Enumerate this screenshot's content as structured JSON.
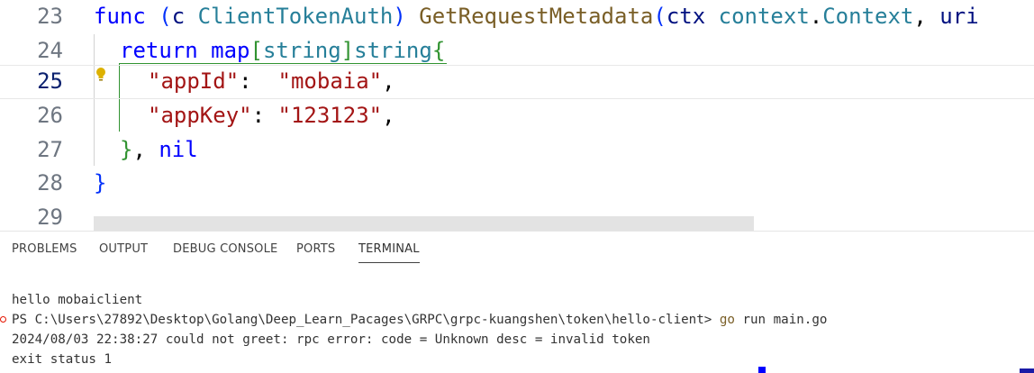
{
  "editor": {
    "lines": [
      {
        "num": "23"
      },
      {
        "num": "24"
      },
      {
        "num": "25"
      },
      {
        "num": "26"
      },
      {
        "num": "27"
      },
      {
        "num": "28"
      },
      {
        "num": "29"
      }
    ],
    "l23": {
      "func": "func",
      "open": "(",
      "recv": "c",
      "type": "ClientTokenAuth",
      "close": ")",
      "name": "GetRequestMetadata",
      "paren": "(",
      "param": "ctx",
      "pkg": "context",
      "dot": ".",
      "ctxType": "Context",
      "comma": ",",
      "tail": "uri"
    },
    "l24": {
      "ret": "return",
      "map": "map",
      "lb": "[",
      "keyType": "string",
      "rb": "]",
      "valType": "string",
      "brace": "{"
    },
    "l25": {
      "key": "\"appId\"",
      "colon": ":",
      "val": "\"mobaia\"",
      "comma": ","
    },
    "l26": {
      "key": "\"appKey\"",
      "colon": ":",
      "val": "\"123123\"",
      "comma": ","
    },
    "l27": {
      "brace": "}",
      "comma": ",",
      "nil": "nil"
    },
    "l28": {
      "brace": "}"
    },
    "icons": {
      "lightbulb": "lightbulb-icon"
    }
  },
  "panel": {
    "tabs": [
      {
        "label": "PROBLEMS"
      },
      {
        "label": "OUTPUT"
      },
      {
        "label": "DEBUG CONSOLE"
      },
      {
        "label": "PORTS"
      },
      {
        "label": "TERMINAL"
      }
    ],
    "terminal": {
      "line1": "hello mobaiclient",
      "prompt": "PS C:\\Users\\27892\\Desktop\\Golang\\Deep_Learn_Pacages\\GRPC\\grpc-kuangshen\\token\\hello-client> ",
      "cmd_go": "go",
      "cmd_rest": " run main.go",
      "line3": "2024/08/03 22:38:27 could not greet: rpc error: code = Unknown desc = invalid token",
      "line4": "exit status 1"
    }
  },
  "colors": {
    "keyword": "#0000ff",
    "type": "#267f99",
    "function": "#795e26",
    "string": "#a31515",
    "error": "#e51400"
  }
}
